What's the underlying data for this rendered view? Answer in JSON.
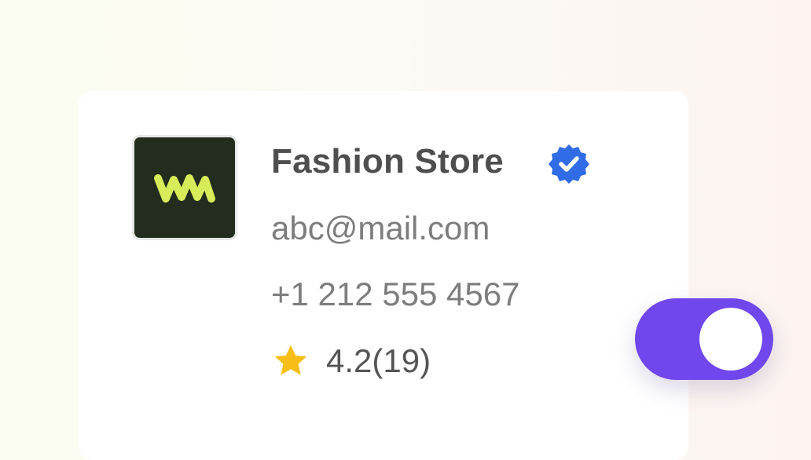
{
  "store": {
    "name": "Fashion Store",
    "email": "abc@mail.com",
    "phone": "+1 212 555 4567",
    "rating": "4.2(19)",
    "verified": true,
    "logo_icon": "wave-logo-icon",
    "verified_icon": "verified-badge-icon",
    "star_icon": "star-icon"
  },
  "toggle": {
    "state": "on",
    "color": "#7047ec"
  },
  "colors": {
    "logo_background": "#232c1d",
    "logo_mark": "#d8ec5a",
    "verified": "#2f6ce6",
    "star": "#f7be18"
  }
}
